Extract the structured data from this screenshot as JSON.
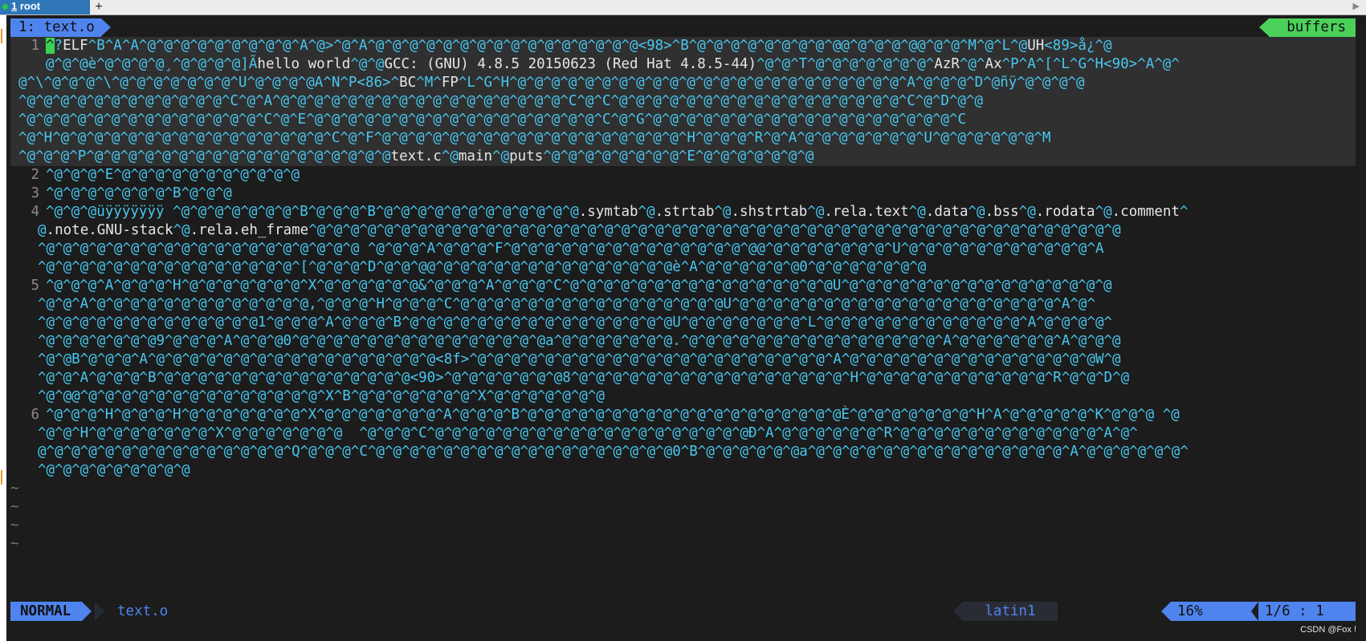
{
  "tabs": [
    {
      "number": "1",
      "label": "root"
    }
  ],
  "tab_add": "+",
  "tab_scroll_right": "▶",
  "buffer": {
    "name": "1: text.o",
    "buffers_label": "buffers"
  },
  "lines": [
    {
      "n": "1",
      "text": "?ELF^B^A^A^@^@^@^@^@^@^@^@^@^A^@>^@^A^@^@^@^@^@^@^@^@^@^@^@^@^@^@^@^@<98>^B^@^@^@^@^@^@^@^@^@@^@^@^@^@@^@^@^M^@^L^@UH<89>å¿^@"
    },
    {
      "n": "",
      "text": "@^@^@è^@^@^@^@¸^@^@^@^@]Ãhello world^@^@GCC: (GNU) 4.8.5 20150623 (Red Hat 4.8.5-44)^@^@^T^@^@^@^@^@^@^@^AzR^@^Ax^P^A^[^L^G^H<90>^A^@^"
    },
    {
      "n": "",
      "text": "@^\\^@^@^@^\\^@^@^@^@^@^@^@^U^@^@^@^@A^N^P<86>^BC^M^FP^L^G^H^@^@^@^@^@^@^@^@^@^@^@^@^@^@^@^@^@^@^@^@^@^@^@^A^@^@^@^D^@ñÿ^@^@^@^@"
    },
    {
      "n": "",
      "text": "^@^@^@^@^@^@^@^@^@^@^@^@^C^@^A^@^@^@^@^@^@^@^@^@^@^@^@^@^@^@^@^@^C^@^C^@^@^@^@^@^@^@^@^@^@^@^@^@^@^@^@^@^C^@^D^@^@"
    },
    {
      "n": "",
      "text": "^@^@^@^@^@^@^@^@^@^@^@^@^@^@^C^@^E^@^@^@^@^@^@^@^@^@^@^@^@^@^@^@^@^@^C^@^G^@^@^@^@^@^@^@^@^@^@^@^@^@^@^@^@^@^@^C"
    },
    {
      "n": "",
      "text": "^@^H^@^@^@^@^@^@^@^@^@^@^@^@^@^@^@^@^C^@^F^@^@^@^@^@^@^@^@^@^@^@^@^@^@^@^@^@^@^H^@^@^@^R^@^A^@^@^@^@^@^@^@^U^@^@^@^@^@^@^M"
    },
    {
      "n": "",
      "text": "^@^@^@^P^@^@^@^@^@^@^@^@^@^@^@^@^@^@^@^@^@^@text.c^@main^@puts^@^@^@^@^@^@^@^@^E^@^@^@^@^@^@^@"
    },
    {
      "n": "2",
      "text": "^@^@^@^E^@^@^@^@^@^@^@^@^@^@^@"
    },
    {
      "n": "3",
      "text": "^@^@^@^@^@^@^@^B^@^@^@"
    },
    {
      "n": "4",
      "text": "^@^@^@üÿÿÿÿÿÿÿ ^@^@^@^@^@^@^@^B^@^@^@^B^@^@^@^@^@^@^@^@^@^@^@^@.symtab^@.strtab^@.shstrtab^@.rela.text^@.data^@.bss^@.rodata^@.comment^"
    },
    {
      "n": "",
      "text": "@.note.GNU-stack^@.rela.eh_frame^@^@^@^@^@^@^@^@^@^@^@^@^@^@^@^@^@^@^@^@^@^@^@^@^@^@^@^@^@^@^@^@^@^@^@^@^@^@^@^@^@^@^@^@^@^@^@^@"
    },
    {
      "n": "",
      "text": "^@^@^@^@^@^@^@^@^@^@^@^@^@^@^@^@^@^@^@ ^@^@^@^A^@^@^@^F^@^@^@^@^@^@^@^@^@^@^@^@^@^@^@@^@^@^@^@^@^@^@^U^@^@^@^@^@^@^@^@^@^@^@^A"
    },
    {
      "n": "",
      "text": "^@^@^@^@^@^@^@^@^@^@^@^@^@^@^@^[^@^@^@^D^@^@^@@^@^@^@^@^@^@^@^@^@^@^@^@^@^@è^A^@^@^@^@^@^@0^@^@^@^@^@^@^@"
    },
    {
      "n": "5",
      "text": "^@^@^@^A^@^@^@^H^@^@^@^@^@^@^@^X^@^@^@^@^@^@&^@^@^@^A^@^@^@^C^@^@^@^@^@^@^@^@^@^@^@^@^@^@^@^@U^@^@^@^@^@^@^@^@^@^@^@^@^@^@^@^@"
    },
    {
      "n": "",
      "text": "^@^@^A^@^@^@^@^@^@^@^@^@^@^@^@^@,^@^@^@^H^@^@^@^C^@^@^@^@^@^@^@^@^@^@^@^@^@^@^@^@U^@^@^@^@^@^@^@^@^@^@^@^@^@^@^@^@^@^@^@^A^@^"
    },
    {
      "n": "",
      "text": "^@^@^@^@^@^@^@^@^@^@^@^@^@1^@^@^@^A^@^@^@^B^@^@^@^@^@^@^@^@^@^@^@^@^@^@^@^@U^@^@^@^@^@^@^@^L^@^@^@^@^@^@^@^@^@^@^@^@^A^@^@^@^@^"
    },
    {
      "n": "",
      "text": "^@^@^@^@^@^@^@9^@^@^@^A^@^@^@0^@^@^@^@^@^@^@^@^@^@^@^@^@^@^@a^@^@^@^@^@^@^@.^@^@^@^@^@^@^@^@^@^@^@^@^@^@^@^A^@^@^@^@^@^@^A^@^@^@"
    },
    {
      "n": "",
      "text": "^@^@B^@^@^@^A^@^@^@^@^@^@^@^@^@^@^@^@^@^@^@^@^@<8f>^@^@^@^@^@^@^@^@^@^@^@^@^@^@^@^@^@^@^@^@^@^A^@^@^@^@^@^@^@^@^@^@^@^@^@^@^@W^@"
    },
    {
      "n": "",
      "text": "^@^@^A^@^@^@^B^@^@^@^@^@^@^@^@^@^@^@^@^@^@^@<90>^@^@^@^@^@^@^@8^@^@^@^@^@^@^@^@^@^@^@^@^@^@^@^@^H^@^@^@^@^@^@^@^@^@^@^@^R^@^@^D^@"
    },
    {
      "n": "",
      "text": "^@^@@^@^@^@^@^@^@^@^@^@^@^@^@^@^@^X^B^@^@^@^@^@^@^@^X^@^@^@^@^@^@^@"
    },
    {
      "n": "6",
      "text": "^@^@^@^H^@^@^@^H^@^@^@^@^@^@^@^X^@^@^@^@^@^@^@^A^@^@^@^B^@^@^@^@^@^@^@^@^@^@^@^@^@^@^@^@^@^@^@È^@^@^@^@^@^@^@^H^A^@^@^@^@^@^K^@^@^@ ^@"
    },
    {
      "n": "",
      "text": "^@^@^H^@^@^@^@^@^@^@^X^@^@^@^@^@^@^@  ^@^@^@^C^@^@^@^@^@^@^@^@^@^@^@^@^@^@^@^@^@^@^@Ð^A^@^@^@^@^@^@^R^@^@^@^@^@^@^@^@^@^@^@^@^A^@^"
    },
    {
      "n": "",
      "text": "@^@^@^@^@^@^@^@^@^@^@^@^@^@^@^Q^@^@^@^C^@^@^@^@^@^@^@^@^@^@^@^@^@^@^@^@^@^@0^B^@^@^@^@^@^@a^@^@^@^@^@^@^@^@^@^@^@^@^@^@^@^A^@^@^@^@^@^@^"
    },
    {
      "n": "",
      "text": "^@^@^@^@^@^@^@^@^@"
    },
    {
      "n": "",
      "text": "~"
    },
    {
      "n": "",
      "text": "~"
    },
    {
      "n": "",
      "text": "~"
    },
    {
      "n": "",
      "text": "~"
    }
  ],
  "status": {
    "mode": "NORMAL",
    "file": "text.o",
    "encoding": "latin1",
    "percent": "16%",
    "position": "1/6 :  1"
  },
  "watermark": "CSDN @Fox !"
}
